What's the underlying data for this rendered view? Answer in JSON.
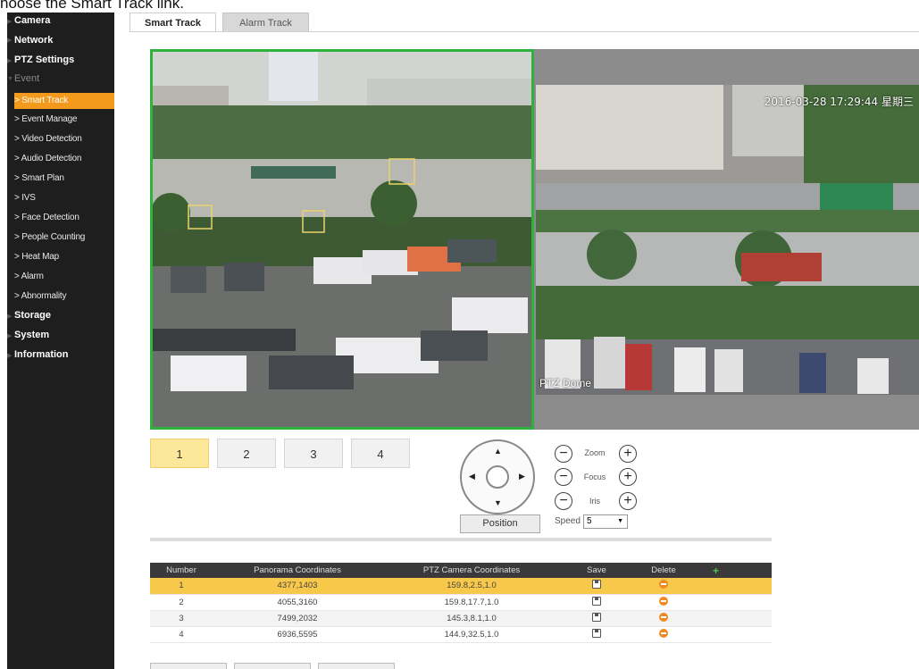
{
  "instruction": "hoose the Smart Track link.",
  "sidebar": {
    "top1": [
      "Camera",
      "Network",
      "PTZ Settings"
    ],
    "event_label": "Event",
    "sub_items": [
      "Smart Track",
      "Event Manage",
      "Video Detection",
      "Audio Detection",
      "Smart Plan",
      "IVS",
      "Face Detection",
      "People Counting",
      "Heat Map",
      "Alarm",
      "Abnormality"
    ],
    "active_sub_index": 0,
    "top2": [
      "Storage",
      "System",
      "Information"
    ]
  },
  "tabs": {
    "smart_track": "Smart Track",
    "alarm_track": "Alarm Track"
  },
  "video": {
    "ptz_time": "2016-03-28 17:29:44 星期三",
    "ptz_label": "PTZ Dome"
  },
  "channels": [
    "1",
    "2",
    "3",
    "4"
  ],
  "controls": {
    "zoom": "Zoom",
    "focus": "Focus",
    "iris": "Iris",
    "minus": "−",
    "plus": "+",
    "position_button": "Position",
    "speed_label": "Speed",
    "speed_value": "5"
  },
  "table": {
    "headers": {
      "number": "Number",
      "panorama": "Panorama Coordinates",
      "ptz": "PTZ Camera Coordinates",
      "save": "Save",
      "delete": "Delete",
      "add": "+"
    },
    "rows": [
      {
        "number": "1",
        "panorama": "4377,1403",
        "ptz": "159.8,2.5,1.0"
      },
      {
        "number": "2",
        "panorama": "4055,3160",
        "ptz": "159.8,17.7,1.0"
      },
      {
        "number": "3",
        "panorama": "7499,2032",
        "ptz": "145.3,8.1,1.0"
      },
      {
        "number": "4",
        "panorama": "6936,5595",
        "ptz": "144.9,32.5,1.0"
      }
    ]
  }
}
